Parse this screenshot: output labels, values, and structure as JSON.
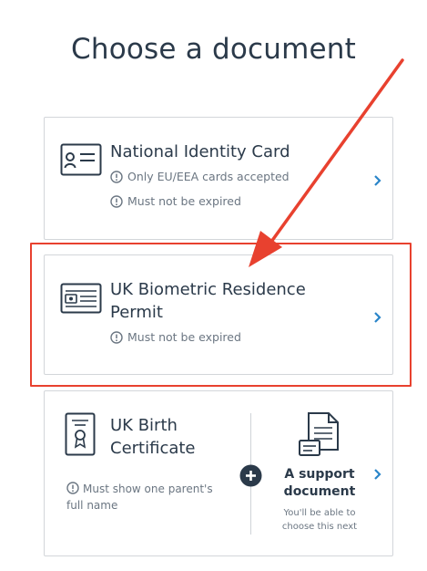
{
  "page": {
    "title": "Choose a document"
  },
  "documents": [
    {
      "title": "National Identity Card",
      "notes": [
        "Only EU/EEA cards accepted",
        "Must not be expired"
      ],
      "icon": "id-card-icon"
    },
    {
      "title_line1": "UK Biometric Residence",
      "title_line2": "Permit",
      "notes": [
        "Must not be expired"
      ],
      "icon": "residence-permit-icon",
      "highlighted": true
    },
    {
      "title_line1": "UK Birth",
      "title_line2": "Certificate",
      "note": "Must show one parent's full name",
      "icon": "certificate-icon",
      "support": {
        "title_line1": "A support",
        "title_line2": "document",
        "subtitle_line1": "You'll be able to",
        "subtitle_line2": "choose this next",
        "icon": "support-document-icon"
      }
    }
  ],
  "colors": {
    "text": "#2b3a4a",
    "muted": "#6b7682",
    "chevron": "#2a85c9",
    "highlight": "#e8412f",
    "border": "#d3d6da"
  }
}
